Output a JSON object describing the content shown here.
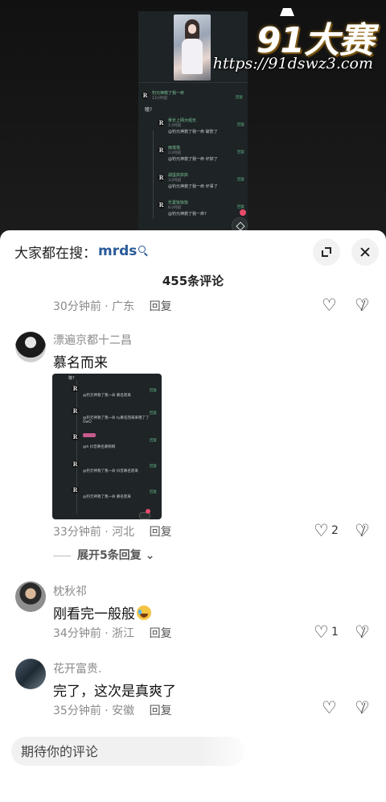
{
  "watermark": {
    "logo": "91大赛",
    "url": "https://91dswz3.com"
  },
  "video_thumb": {
    "top_comment": {
      "name": "钓元神救了我一命",
      "time": "13小时前",
      "text": "瞳?"
    },
    "replies": [
      {
        "name": "吴长上网大组长",
        "time": "1小时前",
        "text": "@钓元神救了我一命 破防了"
      },
      {
        "name": "雨落落",
        "time": "2小时前",
        "text": "@钓元神救了我一命 坏掉了"
      },
      {
        "name": "胡蛋拱拱拱",
        "time": "3小时前",
        "text": "@钓元神救了我一命 坏事了"
      },
      {
        "name": "乐曼饭饭饭",
        "time": "6小时前",
        "text": "@钓元神救了我一命?"
      }
    ],
    "reply_label": "回复"
  },
  "header": {
    "search_prefix": "大家都在搜：",
    "search_term": "mrds",
    "comment_count": "455条评论"
  },
  "comments": [
    {
      "meta_time": "30分钟前 · 广东",
      "reply": "回复"
    },
    {
      "user": "漂遍京都十二昌",
      "text": "慕名而来",
      "meta_time": "33分钟前 · 河北",
      "reply": "回复",
      "likes": "2",
      "expand": "展开5条回复",
      "image_replies": [
        {
          "text": "瞳?"
        },
        {
          "text": "@钓元神救了我一命 慕名而来"
        },
        {
          "text": "@钓元神救了我一命 ty慕名而来来哦了了"
        },
        {
          "text": "OwO"
        },
        {
          "text": "@h 抖音慕名慕频啊"
        },
        {
          "text": "@钓元神救了我一命 抖音慕名而来"
        },
        {
          "text": "@钓元神救了我一命 慕名而来"
        }
      ]
    },
    {
      "user": "枕秋祁",
      "text": "刚看完一般般",
      "meta_time": "34分钟前 · 浙江",
      "reply": "回复",
      "likes": "1"
    },
    {
      "user": "花开富贵.",
      "text": "完了，这次是真爽了",
      "meta_time": "35分钟前 · 安徽",
      "reply": "回复"
    }
  ],
  "input": {
    "placeholder": "期待你的评论"
  }
}
